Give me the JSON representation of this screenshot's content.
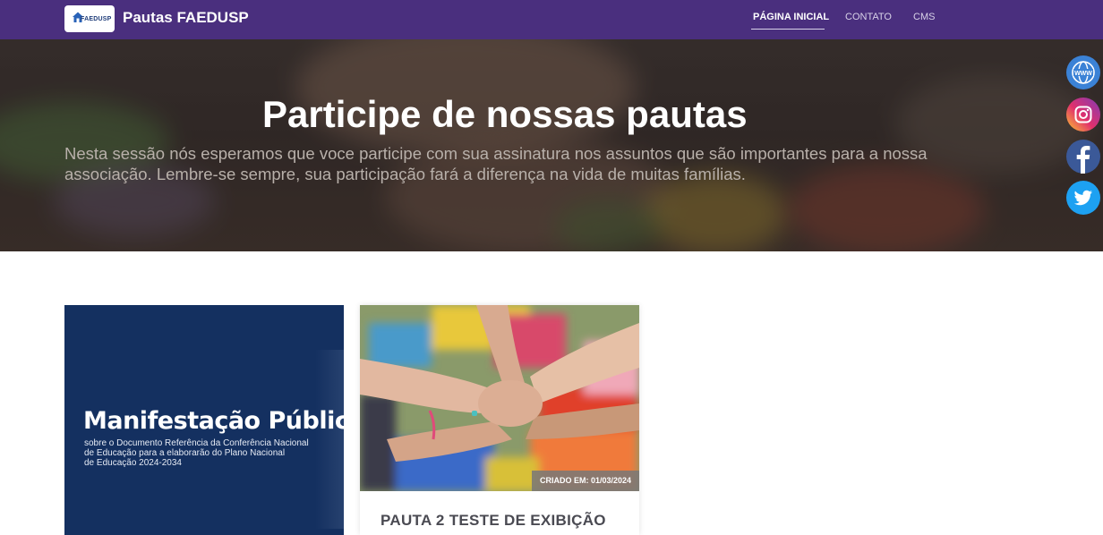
{
  "navbar": {
    "logo_text": "FAEDUSP",
    "brand": "Pautas FAEDUSP",
    "links": [
      {
        "label": "PÁGINA INICIAL",
        "active": true
      },
      {
        "label": "CONTATO",
        "active": false
      },
      {
        "label": "CMS",
        "active": false
      }
    ]
  },
  "hero": {
    "title": "Participe de nossas pautas",
    "text": "Nesta sessão nós esperamos que voce participe com sua assinatura nos assuntos que são importantes para a nossa associação. Lembre-se sempre, sua participação fará a diferença na vida de muitas famílias."
  },
  "social": [
    {
      "icon": "www-icon",
      "label": "WWW",
      "color": "#3b82d6"
    },
    {
      "icon": "instagram-icon",
      "color": "#d6249f"
    },
    {
      "icon": "facebook-icon",
      "color": "#3b5998"
    },
    {
      "icon": "twitter-icon",
      "color": "#1da1f2"
    }
  ],
  "cards": [
    {
      "image_title": "Manifestação Pública",
      "image_subtitle_lines": [
        "sobre o Documento Referência da Conferência Nacional",
        "de Educação para a elaborarão do Plano Nacional",
        "de Educação 2024-2034"
      ]
    },
    {
      "date_badge": "CRIADO EM: 01/03/2024",
      "title": "PAUTA 2 TESTE DE EXIBIÇÃO"
    }
  ],
  "colors": {
    "navbar_bg": "#4a2f7e",
    "card1_bg": "#143060"
  }
}
